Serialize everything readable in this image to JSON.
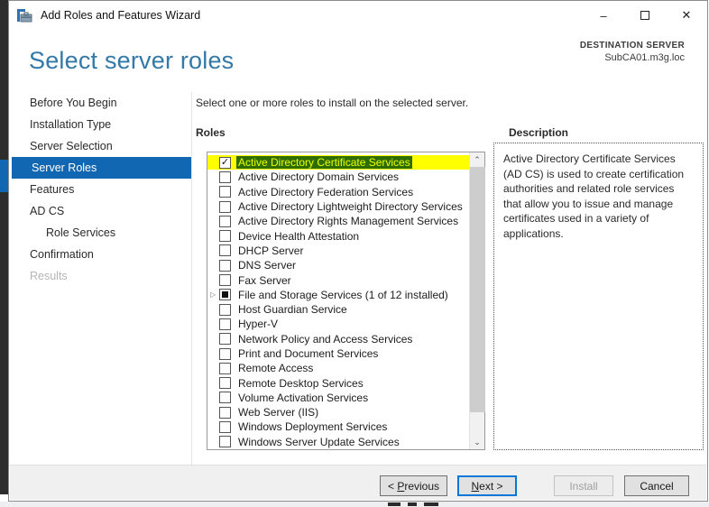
{
  "window": {
    "title": "Add Roles and Features Wizard",
    "icons": {
      "minimize": "–",
      "maximize": "□",
      "close": "✕",
      "scroll_up": "⌃",
      "scroll_down": "⌄",
      "expander": "▷"
    }
  },
  "header": {
    "page_title": "Select server roles",
    "destination_label": "DESTINATION SERVER",
    "destination_server": "SubCA01.m3g.loc"
  },
  "sidebar": {
    "items": [
      {
        "label": "Before You Begin",
        "state": "normal",
        "indent": false
      },
      {
        "label": "Installation Type",
        "state": "normal",
        "indent": false
      },
      {
        "label": "Server Selection",
        "state": "normal",
        "indent": false
      },
      {
        "label": "Server Roles",
        "state": "selected",
        "indent": false
      },
      {
        "label": "Features",
        "state": "normal",
        "indent": false
      },
      {
        "label": "AD CS",
        "state": "normal",
        "indent": false
      },
      {
        "label": "Role Services",
        "state": "normal",
        "indent": true
      },
      {
        "label": "Confirmation",
        "state": "normal",
        "indent": false
      },
      {
        "label": "Results",
        "state": "disabled",
        "indent": false
      }
    ]
  },
  "main": {
    "instruction": "Select one or more roles to install on the selected server.",
    "roles_label": "Roles",
    "description_label": "Description",
    "description_text": "Active Directory Certificate Services (AD CS) is used to create certification authorities and related role services that allow you to issue and manage certificates used in a variety of applications.",
    "roles": [
      {
        "label": "Active Directory Certificate Services",
        "state": "checked",
        "highlighted": true,
        "expandable": false
      },
      {
        "label": "Active Directory Domain Services",
        "state": "unchecked",
        "highlighted": false,
        "expandable": false
      },
      {
        "label": "Active Directory Federation Services",
        "state": "unchecked",
        "highlighted": false,
        "expandable": false
      },
      {
        "label": "Active Directory Lightweight Directory Services",
        "state": "unchecked",
        "highlighted": false,
        "expandable": false
      },
      {
        "label": "Active Directory Rights Management Services",
        "state": "unchecked",
        "highlighted": false,
        "expandable": false
      },
      {
        "label": "Device Health Attestation",
        "state": "unchecked",
        "highlighted": false,
        "expandable": false
      },
      {
        "label": "DHCP Server",
        "state": "unchecked",
        "highlighted": false,
        "expandable": false
      },
      {
        "label": "DNS Server",
        "state": "unchecked",
        "highlighted": false,
        "expandable": false
      },
      {
        "label": "Fax Server",
        "state": "unchecked",
        "highlighted": false,
        "expandable": false
      },
      {
        "label": "File and Storage Services (1 of 12 installed)",
        "state": "partial",
        "highlighted": false,
        "expandable": true
      },
      {
        "label": "Host Guardian Service",
        "state": "unchecked",
        "highlighted": false,
        "expandable": false
      },
      {
        "label": "Hyper-V",
        "state": "unchecked",
        "highlighted": false,
        "expandable": false
      },
      {
        "label": "Network Policy and Access Services",
        "state": "unchecked",
        "highlighted": false,
        "expandable": false
      },
      {
        "label": "Print and Document Services",
        "state": "unchecked",
        "highlighted": false,
        "expandable": false
      },
      {
        "label": "Remote Access",
        "state": "unchecked",
        "highlighted": false,
        "expandable": false
      },
      {
        "label": "Remote Desktop Services",
        "state": "unchecked",
        "highlighted": false,
        "expandable": false
      },
      {
        "label": "Volume Activation Services",
        "state": "unchecked",
        "highlighted": false,
        "expandable": false
      },
      {
        "label": "Web Server (IIS)",
        "state": "unchecked",
        "highlighted": false,
        "expandable": false
      },
      {
        "label": "Windows Deployment Services",
        "state": "unchecked",
        "highlighted": false,
        "expandable": false
      },
      {
        "label": "Windows Server Update Services",
        "state": "unchecked",
        "highlighted": false,
        "expandable": false
      }
    ]
  },
  "footer": {
    "buttons": {
      "previous": {
        "pre": "< ",
        "key": "P",
        "rest": "revious"
      },
      "next": {
        "pre": "",
        "key": "N",
        "rest": "ext >"
      },
      "install": {
        "label": "Install"
      },
      "cancel": {
        "label": "Cancel"
      }
    }
  },
  "colors": {
    "heading": "#3379a8",
    "sidebar_selected": "#1167b1",
    "highlight": "#ffff00",
    "highlight_label_bg": "#2f6d00",
    "highlight_label_text": "#eaff00",
    "default_button_border": "#0078d7"
  }
}
